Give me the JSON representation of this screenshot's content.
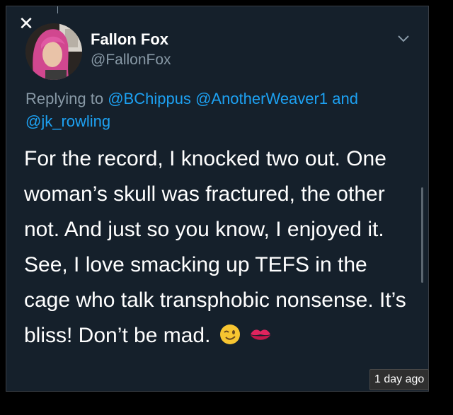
{
  "tweet": {
    "author_name": "Fallon Fox",
    "author_handle": "@FallonFox",
    "reply_prefix": "Replying to",
    "reply_mentions": [
      "@BChippus",
      "@AnotherWeaver1",
      "@jk_rowling"
    ],
    "reply_joiner": "and",
    "body": "For the record, I knocked two out. One woman’s skull was fractured, the other not. And just so you know, I enjoyed it. See, I love smacking up TEFS in the cage who talk transphobic nonsense. It’s bliss! Don’t be mad.",
    "emojis": [
      "winking-face-emoji",
      "kiss-mark-emoji"
    ]
  },
  "overlay": {
    "close_symbol": "✕",
    "timestamp": "1 day ago"
  },
  "colors": {
    "background": "#15202b",
    "text": "#ffffff",
    "muted": "#8899a6",
    "accent": "#1da1f2"
  }
}
